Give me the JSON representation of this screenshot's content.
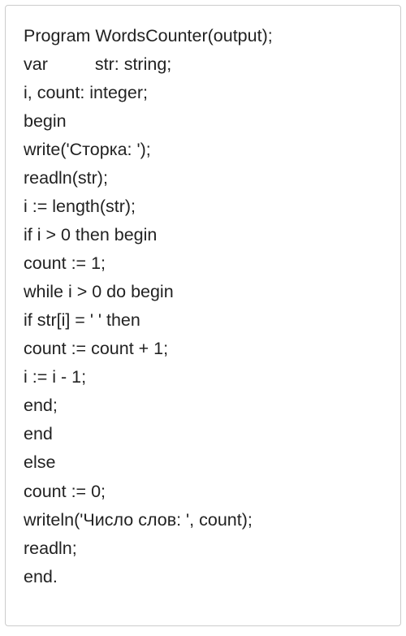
{
  "lines": [
    "Program WordsCounter(output);",
    {
      "prefix": "var",
      "indented": "str: string;"
    },
    "i, count: integer;",
    "begin",
    "write('Сторка: ');",
    "readln(str);",
    "i := length(str);",
    "if i > 0 then begin",
    "count := 1;",
    "while i > 0 do begin",
    "if str[i] = ' ' then",
    "count := count + 1;",
    "i := i - 1;",
    "end;",
    "end",
    "else",
    "count := 0;",
    "writeln('Число слов: ', count);",
    "readln;",
    "end."
  ]
}
